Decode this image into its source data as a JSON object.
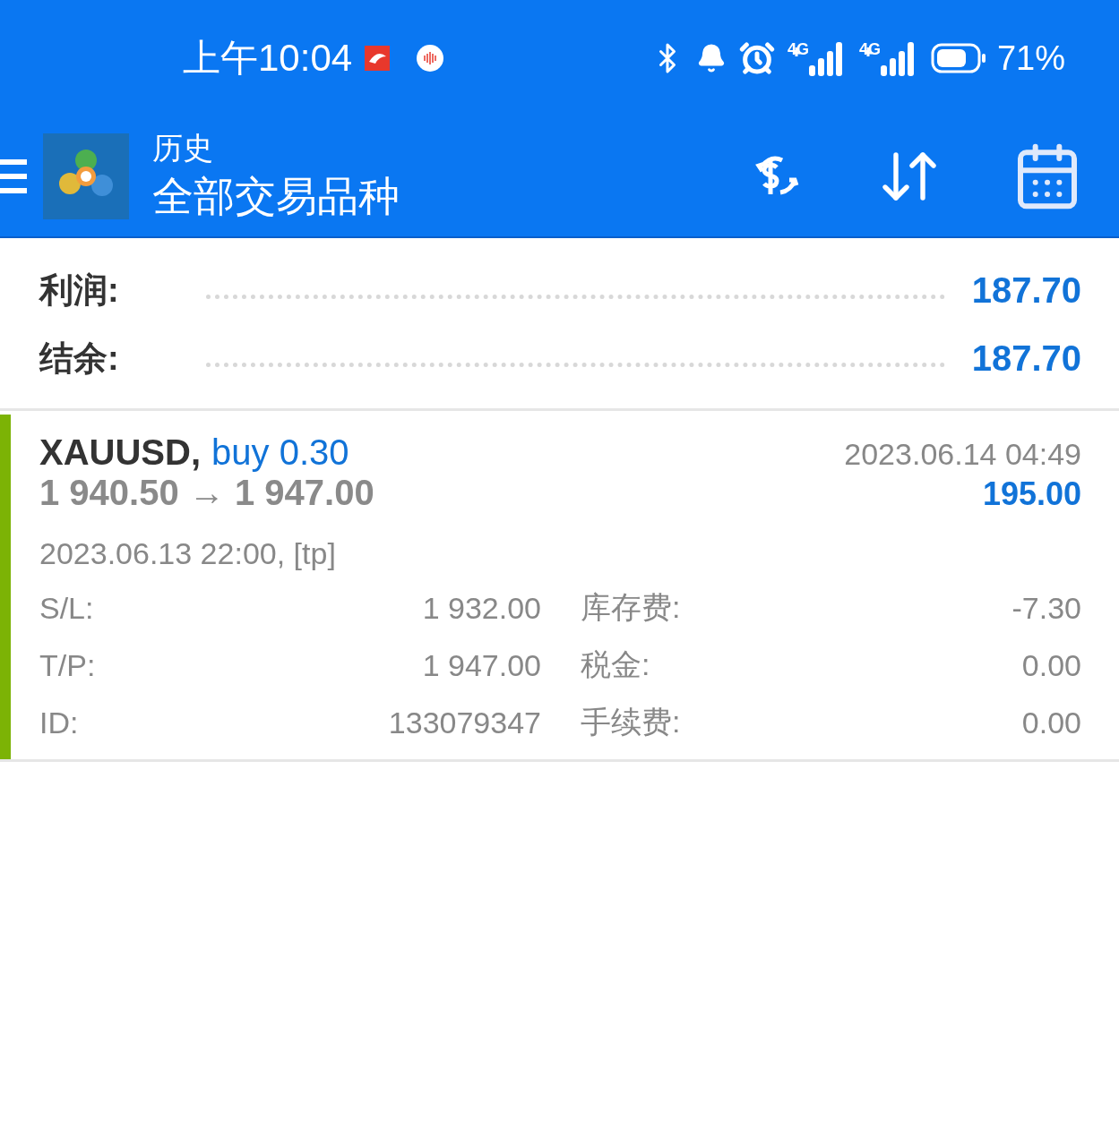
{
  "status_bar": {
    "time": "上午10:04",
    "battery": "71%",
    "networks": [
      "4G",
      "4G"
    ]
  },
  "app_bar": {
    "subtitle": "历史",
    "title": "全部交易品种"
  },
  "summary": [
    {
      "label": "利润:",
      "value": "187.70"
    },
    {
      "label": "结余:",
      "value": "187.70"
    }
  ],
  "trade": {
    "symbol": "XAUUSD,",
    "side": "buy 0.30",
    "close_time": "2023.06.14 04:49",
    "prices": "1 940.50 → 1 947.00",
    "profit": "195.00",
    "open_time": "2023.06.13 22:00, [tp]",
    "details": [
      {
        "label": "S/L:",
        "value": "1 932.00",
        "label_2": "库存费:",
        "value_2": "-7.30"
      },
      {
        "label": "T/P:",
        "value": "1 947.00",
        "label_2": "税金:",
        "value_2": "0.00"
      },
      {
        "label": "ID:",
        "value": "133079347",
        "label_2": "手续费:",
        "value_2": "0.00"
      }
    ]
  }
}
